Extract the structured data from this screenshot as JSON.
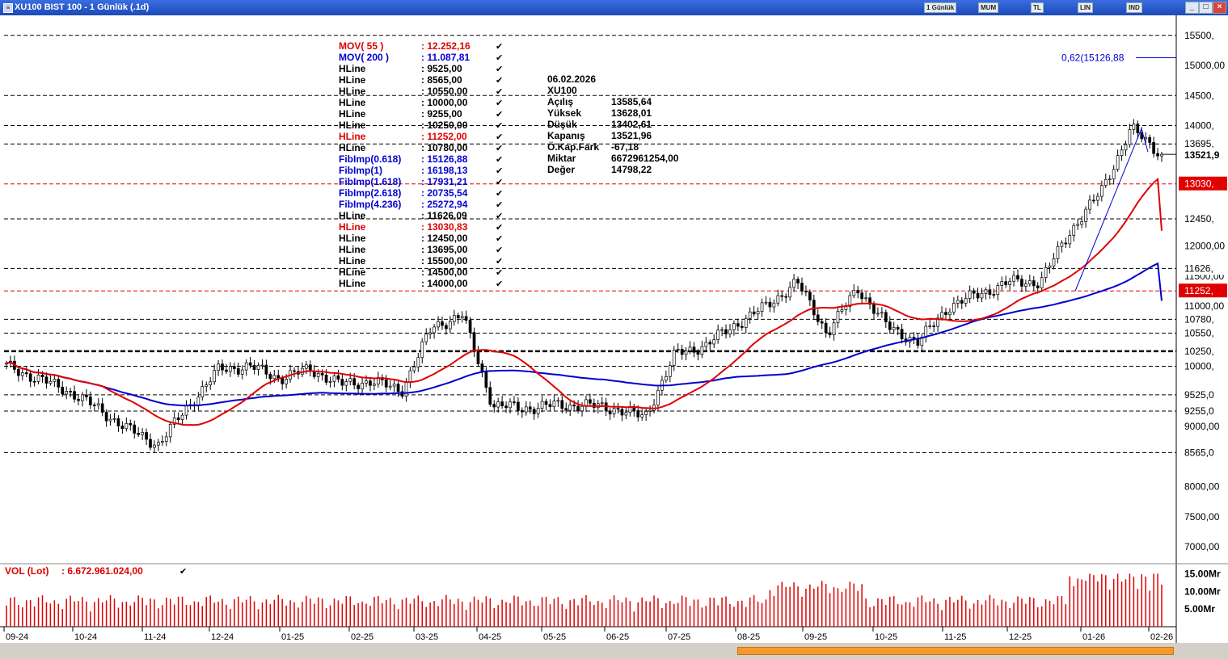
{
  "window": {
    "title": "XU100 BIST 100 - 1 Günlük (.1d)"
  },
  "toolbar": {
    "period": "1 Günlük",
    "items": [
      "MUM",
      "TL",
      "LIN",
      "IND"
    ]
  },
  "info_box": {
    "date": "06.02.2026",
    "symbol": "XU100",
    "rows": [
      {
        "label": "Açılış",
        "value": "13585,64"
      },
      {
        "label": "Yüksek",
        "value": "13628,01"
      },
      {
        "label": "Düşük",
        "value": "13402,61"
      },
      {
        "label": "Kapanış",
        "value": "13521,96"
      },
      {
        "label": "Ö.Kap.Fark",
        "value": "-67,18"
      },
      {
        "label": "Miktar",
        "value": "6672961254,00"
      },
      {
        "label": "Değer",
        "value": "14798,22"
      }
    ]
  },
  "legend": [
    {
      "name": "MOV( 55 )",
      "value": ": 12.252,16",
      "color": "#e00000"
    },
    {
      "name": "MOV( 200 )",
      "value": ": 11.087,81",
      "color": "#0000d0"
    },
    {
      "name": "HLine",
      "value": ": 9525,00",
      "color": "#000000"
    },
    {
      "name": "HLine",
      "value": ": 8565,00",
      "color": "#000000"
    },
    {
      "name": "HLine",
      "value": ": 10550,00",
      "color": "#000000"
    },
    {
      "name": "HLine",
      "value": ": 10000,00",
      "color": "#000000"
    },
    {
      "name": "HLine",
      "value": ": 9255,00",
      "color": "#000000"
    },
    {
      "name": "HLine",
      "value": ": 10250,00",
      "color": "#000000"
    },
    {
      "name": "HLine",
      "value": ": 11252,00",
      "color": "#e00000"
    },
    {
      "name": "HLine",
      "value": ": 10780,00",
      "color": "#000000"
    },
    {
      "name": "FibImp(0.618)",
      "value": ": 15126,88",
      "color": "#0000d0"
    },
    {
      "name": "FibImp(1)",
      "value": ": 16198,13",
      "color": "#0000d0"
    },
    {
      "name": "FibImp(1.618)",
      "value": ": 17931,21",
      "color": "#0000d0"
    },
    {
      "name": "FibImp(2.618)",
      "value": ": 20735,54",
      "color": "#0000d0"
    },
    {
      "name": "FibImp(4.236)",
      "value": ": 25272,94",
      "color": "#0000d0"
    },
    {
      "name": "HLine",
      "value": ": 11626,09",
      "color": "#000000"
    },
    {
      "name": "HLine",
      "value": ": 13030,83",
      "color": "#e00000"
    },
    {
      "name": "HLine",
      "value": ": 12450,00",
      "color": "#000000"
    },
    {
      "name": "HLine",
      "value": ": 13695,00",
      "color": "#000000"
    },
    {
      "name": "HLine",
      "value": ": 15500,00",
      "color": "#000000"
    },
    {
      "name": "HLine",
      "value": ": 14500,00",
      "color": "#000000"
    },
    {
      "name": "HLine",
      "value": ": 14000,00",
      "color": "#000000"
    }
  ],
  "fib_label": "0,62(15126,88",
  "volume": {
    "label": "VOL (Lot)",
    "value": ": 6.672.961.024,00",
    "ticks": [
      "15.00Mr",
      "10.00Mr",
      "5.00Mr"
    ]
  },
  "chart_data": {
    "type": "candlestick",
    "title": "XU100 BIST 100 - 1 Günlük (.1d)",
    "ylim": [
      6800,
      15800
    ],
    "y_tick_labels": [
      "15000,00",
      "12000,00",
      "11500,00",
      "11000,00",
      "9000,00",
      "8000,00",
      "7500,00",
      "7000,00"
    ],
    "y_tick_values": [
      15000,
      12000,
      11500,
      11000,
      9000,
      8000,
      7500,
      7000
    ],
    "hlines": [
      {
        "value": 15500,
        "label": "15500,",
        "color": "#000000"
      },
      {
        "value": 14500,
        "label": "14500,",
        "color": "#000000"
      },
      {
        "value": 14000,
        "label": "14000,",
        "color": "#000000"
      },
      {
        "value": 13695,
        "label": "13695,",
        "color": "#000000"
      },
      {
        "value": 13030.83,
        "label": "13030,",
        "color": "#e00000"
      },
      {
        "value": 12450,
        "label": "12450,",
        "color": "#000000"
      },
      {
        "value": 11626.09,
        "label": "11626,",
        "color": "#000000"
      },
      {
        "value": 11252,
        "label": "11252,",
        "color": "#e00000"
      },
      {
        "value": 10780,
        "label": "10780,",
        "color": "#000000"
      },
      {
        "value": 10550,
        "label": "10550,",
        "color": "#000000"
      },
      {
        "value": 10250,
        "label": "10250,",
        "color": "#000000"
      },
      {
        "value": 10000,
        "label": "10000,",
        "color": "#000000"
      },
      {
        "value": 9525,
        "label": "9525,0",
        "color": "#000000"
      },
      {
        "value": 9255,
        "label": "9255,0",
        "color": "#000000"
      },
      {
        "value": 8565,
        "label": "8565,0",
        "color": "#000000"
      }
    ],
    "last_close_label": "13521,9",
    "last_close": 13521.96,
    "x_labels": [
      "09-24",
      "10-24",
      "11-24",
      "12-24",
      "01-25",
      "02-25",
      "03-25",
      "04-25",
      "05-25",
      "06-25",
      "07-25",
      "08-25",
      "09-25",
      "10-25",
      "11-25",
      "12-25",
      "01-26",
      "02-26"
    ],
    "close_path": [
      [
        "09-24",
        10000
      ],
      [
        "09-24",
        9800
      ],
      [
        "10-24",
        9600
      ],
      [
        "10-24",
        9300
      ],
      [
        "10-24",
        8950
      ],
      [
        "11-24",
        8700
      ],
      [
        "11-24",
        9350
      ],
      [
        "12-24",
        9950
      ],
      [
        "12-24",
        10000
      ],
      [
        "01-25",
        9800
      ],
      [
        "01-25",
        9950
      ],
      [
        "02-25",
        9700
      ],
      [
        "02-25",
        9750
      ],
      [
        "03-25",
        9600
      ],
      [
        "03-25",
        10650
      ],
      [
        "03-25",
        10850
      ],
      [
        "04-25",
        9350
      ],
      [
        "04-25",
        9300
      ],
      [
        "05-25",
        9350
      ],
      [
        "05-25",
        9350
      ],
      [
        "06-25",
        9300
      ],
      [
        "06-25",
        9150
      ],
      [
        "07-25",
        10200
      ],
      [
        "07-25",
        10350
      ],
      [
        "08-25",
        10700
      ],
      [
        "08-25",
        11000
      ],
      [
        "09-25",
        11400
      ],
      [
        "09-25",
        10550
      ],
      [
        "10-25",
        11300
      ],
      [
        "10-25",
        10650
      ],
      [
        "11-25",
        10400
      ],
      [
        "11-25",
        11000
      ],
      [
        "12-25",
        11200
      ],
      [
        "12-25",
        11400
      ],
      [
        "01-26",
        11400
      ],
      [
        "01-26",
        12250
      ],
      [
        "01-26",
        12900
      ],
      [
        "02-26",
        13950
      ],
      [
        "02-26",
        13521.96
      ]
    ],
    "series": [
      {
        "name": "MOV( 55 )",
        "color": "#e00000",
        "last": 12252.16
      },
      {
        "name": "MOV( 200 )",
        "color": "#0000d0",
        "last": 11087.81
      }
    ],
    "fib_impulse": {
      "level": 0.618,
      "value": 15126.88
    },
    "volume_ylim": [
      0,
      16
    ]
  }
}
